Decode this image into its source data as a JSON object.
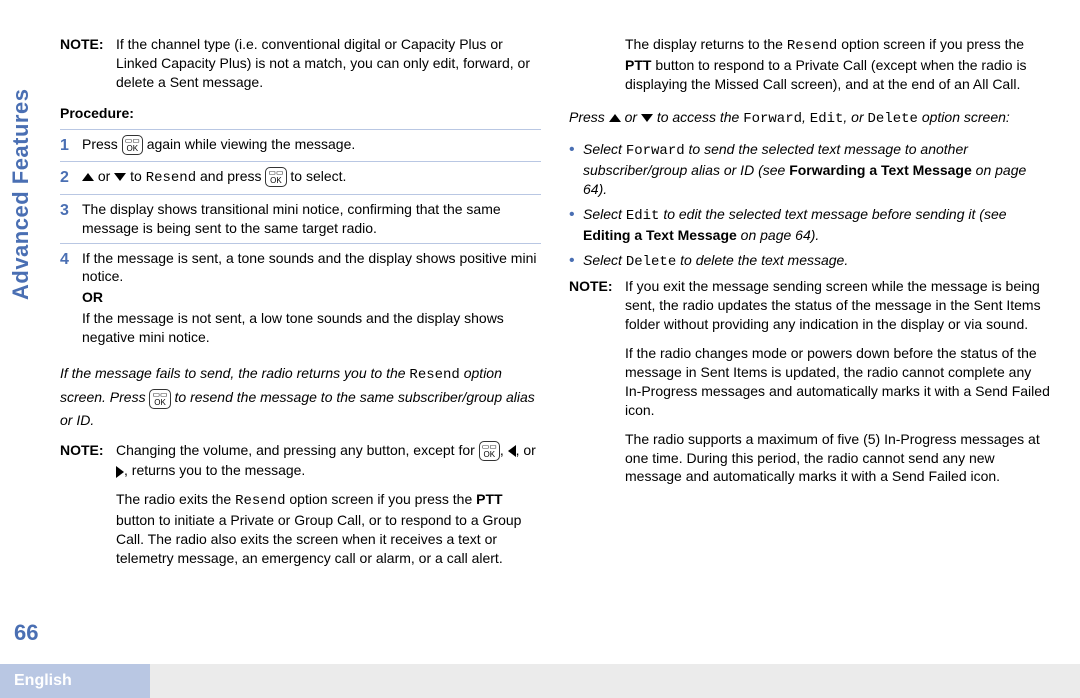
{
  "sidebar": {
    "section_label": "Advanced Features",
    "page_number": "66"
  },
  "footer": {
    "language": "English"
  },
  "left": {
    "top_note": {
      "label": "NOTE:",
      "text": "If the channel type (i.e. conventional digital or Capacity Plus or Linked Capacity Plus) is not a match, you can only edit, forward, or delete a Sent message."
    },
    "procedure_heading": "Procedure:",
    "steps": {
      "s1": {
        "num": "1",
        "t1": "Press ",
        "t2": " again while viewing the message."
      },
      "s2": {
        "num": "2",
        "t1": " or ",
        "t2": " to ",
        "resend": "Resend",
        "t3": " and press ",
        "t4": " to select."
      },
      "s3": {
        "num": "3",
        "text": "The display shows transitional mini notice, confirming that the same message is being sent to the same target radio."
      },
      "s4": {
        "num": "4",
        "p1": "If the message is sent, a tone sounds and the display shows positive mini notice.",
        "or": "OR",
        "p2": "If the message is not sent, a low tone sounds and the display shows negative mini notice."
      }
    },
    "fail_para": {
      "t1": "If the message fails to send, the radio returns you to the ",
      "resend": "Resend",
      "t2": " option screen. Press ",
      "t3": " to resend the message to the same subscriber/group alias or ID."
    },
    "note2": {
      "label": "NOTE:",
      "p1a": "Changing the volume, and pressing any button, except for ",
      "p1b": ", ",
      "p1c": ", or ",
      "p1d": ", returns you to the message.",
      "p2a": "The radio exits the ",
      "resend": "Resend",
      "p2b": " option screen if you press the ",
      "ptt": "PTT",
      "p2c": " button to initiate a Private or Group Call, or to respond to a Group Call. The radio also exits the screen when it receives a text or telemetry message, an emergency call or alarm, or a call alert."
    }
  },
  "right": {
    "cont": {
      "t1": "The display returns to the ",
      "resend": "Resend",
      "t2": " option screen if you press the ",
      "ptt": "PTT",
      "t3": " button to respond to a Private Call (except when the radio is displaying the Missed Call screen), and at the end of an All Call."
    },
    "press_para": {
      "t1": "Press ",
      "t2": " or ",
      "t3": " to access the ",
      "forward": "Forward",
      "comma1": ", ",
      "edit": "Edit",
      "comma2": ", or ",
      "delete": "Delete",
      "t4": " option screen:"
    },
    "bullets": {
      "b1": {
        "t1": "Select ",
        "forward": "Forward",
        "t2": " to send the selected text message to another subscriber/group alias or ID (see ",
        "ref": "Forwarding a Text Message",
        "t3": " on page 64)."
      },
      "b2": {
        "t1": "Select ",
        "edit": "Edit",
        "t2": " to edit the selected text message before sending it (see ",
        "ref": "Editing a Text Message",
        "t3": " on page 64)."
      },
      "b3": {
        "t1": "Select ",
        "delete": "Delete",
        "t2": " to delete the text message."
      }
    },
    "note": {
      "label": "NOTE:",
      "p1": "If you exit the message sending screen while the message is being sent, the radio updates the status of the message in the Sent Items folder without providing any indication in the display or via sound.",
      "p2": "If the radio changes mode or powers down before the status of the message in Sent Items is updated, the radio cannot complete any In-Progress messages and automatically marks it with a Send Failed icon.",
      "p3": "The radio supports a maximum of five (5) In-Progress messages at one time. During this period, the radio cannot send any new message and automatically marks it with a Send Failed icon."
    }
  }
}
